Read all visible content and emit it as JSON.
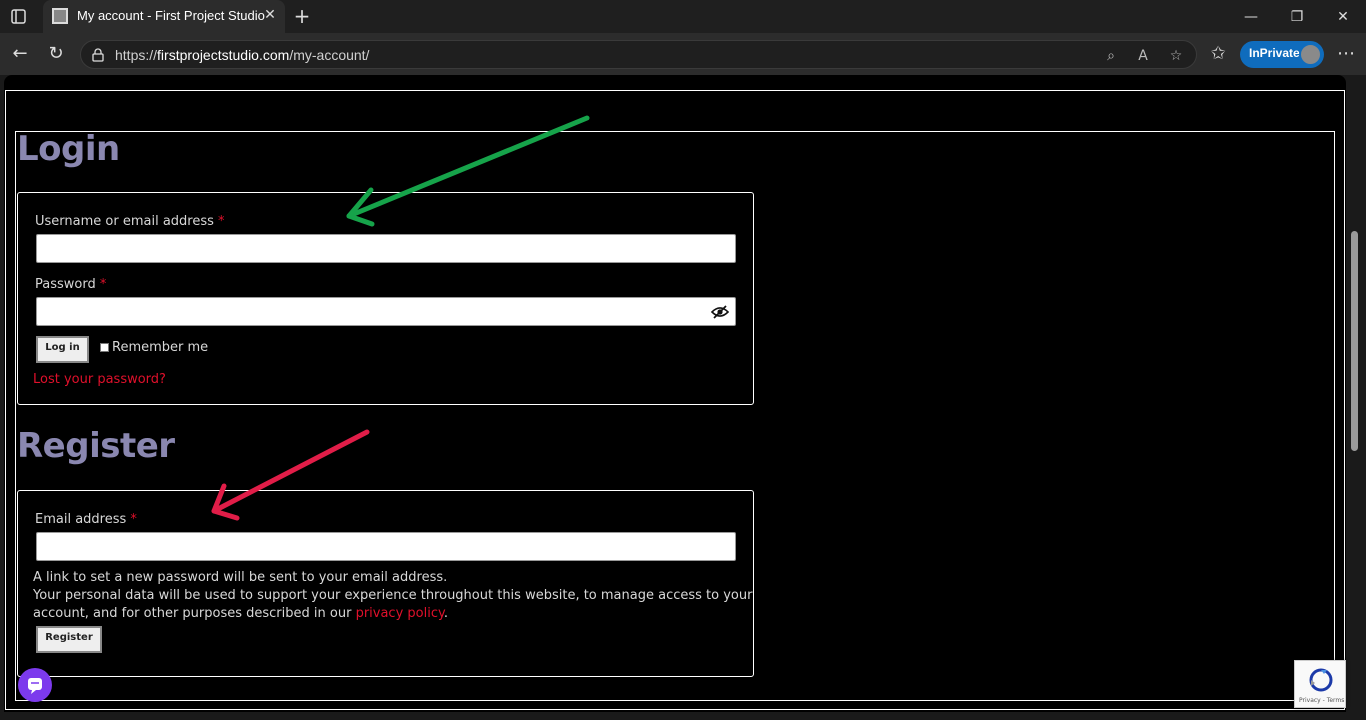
{
  "browser": {
    "tab_title": "My account - First Project Studio",
    "url_prefix": "https://",
    "url_domain": "firstprojectstudio.com",
    "url_path": "/my-account/",
    "inprivate_label": "InPrivate",
    "accent_color": "#0f6cbd"
  },
  "login": {
    "heading": "Login",
    "username_label": "Username or email address",
    "password_label": "Password",
    "required_mark": "*",
    "login_button": "Log in",
    "remember_me": "Remember me",
    "lost_password": "Lost your password?"
  },
  "register": {
    "heading": "Register",
    "email_label": "Email address",
    "required_mark": "*",
    "info_line": "A link to set a new password will be sent to your email address.",
    "privacy_line1": "Your personal data will be used to support your experience throughout this website, to manage access to your",
    "privacy_line2_before": "account, and for other purposes described in our ",
    "privacy_link": "privacy policy",
    "privacy_line2_after": ".",
    "register_button": "Register"
  },
  "recaptcha": {
    "terms": "Privacy - Terms"
  },
  "colors": {
    "heading": "#8a87b0",
    "required": "#e0102b",
    "link": "#e0102b",
    "arrow_green": "#16a34a",
    "arrow_red": "#e11d48"
  }
}
